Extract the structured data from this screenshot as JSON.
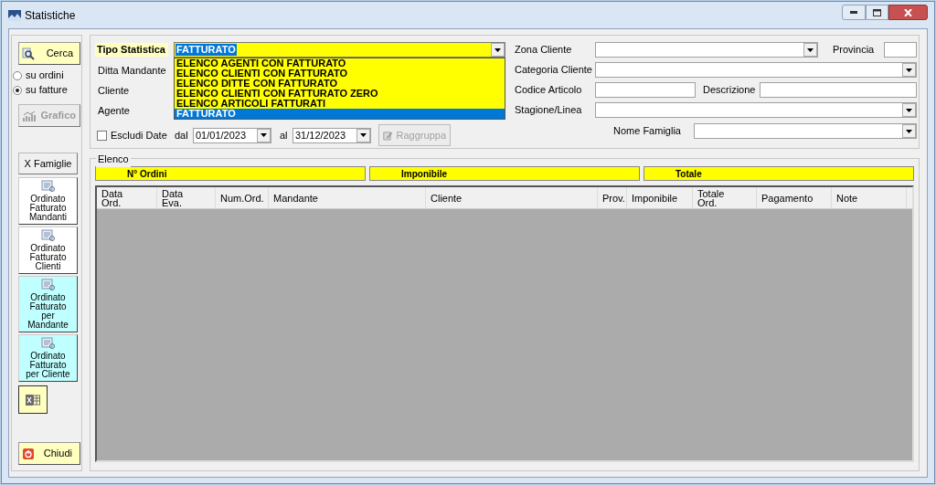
{
  "window": {
    "title": "Statistiche"
  },
  "sidebar": {
    "search_button": "Cerca",
    "modes": [
      {
        "label": "su ordini",
        "selected": false
      },
      {
        "label": "su fatture",
        "selected": true
      }
    ],
    "chart_button": {
      "label": "Grafico",
      "disabled": true
    },
    "family_button": "X Famiglie",
    "tiles": [
      {
        "label": "Ordinato\nFatturato\nMandanti",
        "color": "#ffffff"
      },
      {
        "label": "Ordinato\nFatturato\nClienti",
        "color": "#ffffff"
      },
      {
        "label": "Ordinato\nFatturato\nper\nMandante",
        "color": "#c0ffff"
      },
      {
        "label": "Ordinato\nFatturato\nper Cliente",
        "color": "#c0ffff"
      }
    ],
    "close_button": "Chiudi"
  },
  "filters": {
    "tipo_statistica": {
      "label": "Tipo Statistica",
      "value": "FATTURATO",
      "expanded": true,
      "options": [
        {
          "label": "ELENCO AGENTI CON FATTURATO",
          "selected": false
        },
        {
          "label": "ELENCO CLIENTI CON FATTURATO",
          "selected": false
        },
        {
          "label": "ELENCO DITTE CON FATTURATO",
          "selected": false
        },
        {
          "label": "ELENCO CLIENTI CON FATTURATO ZERO",
          "selected": false
        },
        {
          "label": "ELENCO ARTICOLI FATTURATI",
          "selected": false
        },
        {
          "label": "FATTURATO",
          "selected": true
        }
      ]
    },
    "labels": [
      "Ditta Mandante",
      "Cliente",
      "Agente"
    ],
    "exclude_dates": {
      "label": "Escludi Date",
      "checked": false
    },
    "date_from": {
      "label": "dal",
      "value": "01/01/2023"
    },
    "date_to": {
      "label": "al",
      "value": "31/12/2023"
    },
    "group_button": {
      "label": "Raggruppa",
      "disabled": true
    },
    "zona_cliente": "Zona Cliente",
    "provincia": "Provincia",
    "categoria_cliente": "Categoria Cliente",
    "codice_articolo": "Codice Articolo",
    "descrizione": "Descrizione",
    "stagione_linea": "Stagione/Linea",
    "nome_famiglia": "Nome Famiglia"
  },
  "list": {
    "title": "Elenco",
    "totals": [
      "N° Ordini",
      "Imponibile",
      "Totale"
    ],
    "columns": [
      "Data\nOrd.",
      "Data\nEva.",
      "Num.Ord.",
      "Mandante",
      "Cliente",
      "Prov.",
      "Imponibile",
      "Totale\nOrd.",
      "Pagamento",
      "Note"
    ]
  }
}
